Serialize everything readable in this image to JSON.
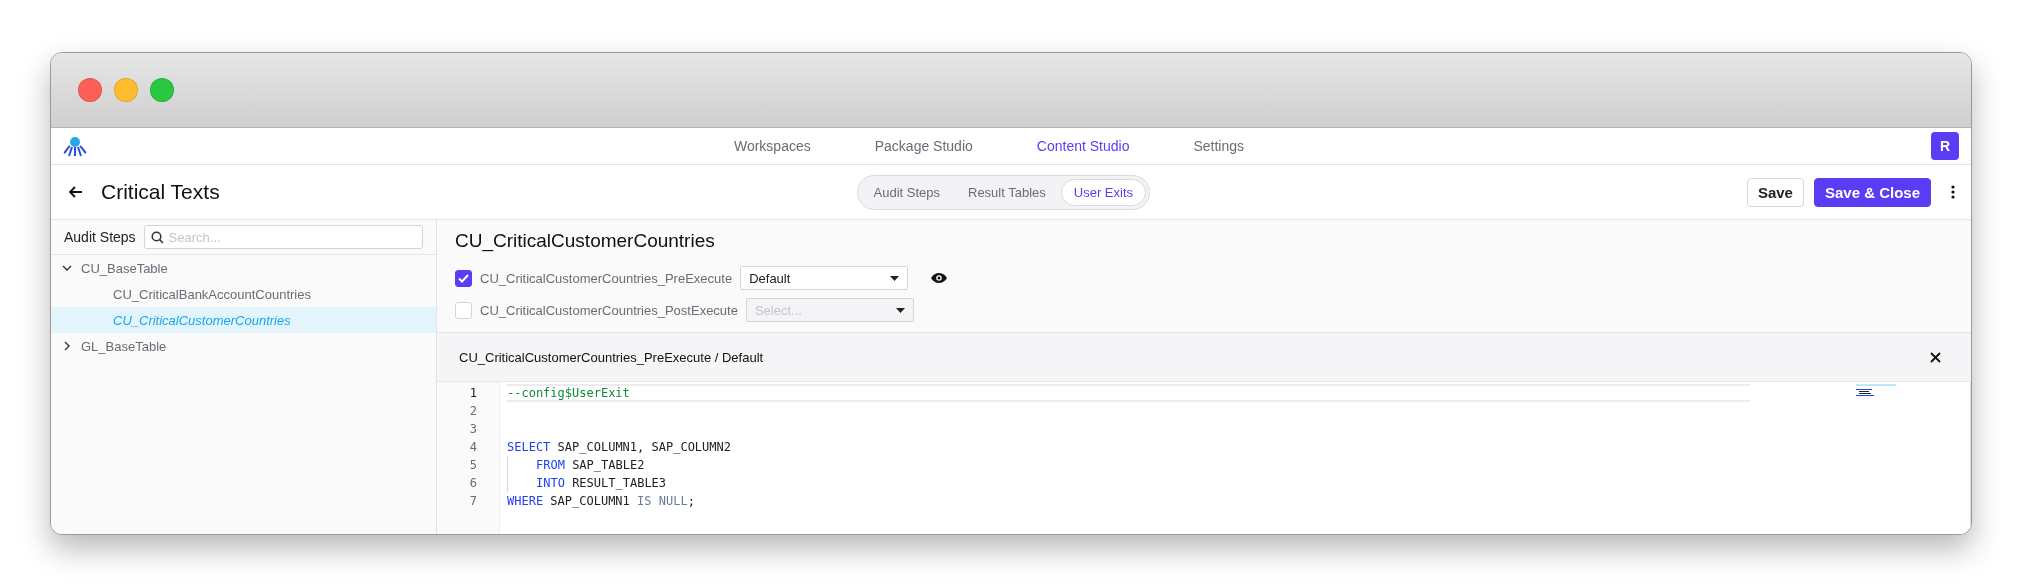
{
  "nav": {
    "items": [
      {
        "label": "Workspaces",
        "selected": false
      },
      {
        "label": "Package Studio",
        "selected": false
      },
      {
        "label": "Content Studio",
        "selected": true
      },
      {
        "label": "Settings",
        "selected": false
      }
    ],
    "avatar": "R"
  },
  "header": {
    "title": "Critical Texts",
    "tabs": [
      {
        "label": "Audit Steps",
        "selected": false
      },
      {
        "label": "Result Tables",
        "selected": false
      },
      {
        "label": "User Exits",
        "selected": true
      }
    ],
    "buttons": [
      {
        "label": "Save",
        "kind": "secondary"
      },
      {
        "label": "Save & Close",
        "kind": "primary"
      }
    ]
  },
  "sidebar": {
    "title": "Audit Steps",
    "search": {
      "placeholder": "Search..."
    },
    "tree": [
      {
        "label": "CU_BaseTable",
        "expanded": true,
        "selected": false,
        "children": [
          {
            "label": "CU_CriticalBankAccountCountries",
            "selected": false
          },
          {
            "label": "CU_CriticalCustomerCountries",
            "selected": true
          }
        ]
      },
      {
        "label": "GL_BaseTable",
        "expanded": false,
        "selected": false
      }
    ]
  },
  "main": {
    "title": "CU_CriticalCustomerCountries",
    "exits": [
      {
        "label": "CU_CriticalCustomerCountries_PreExecute",
        "checked": true,
        "value": "Default",
        "preview": true
      },
      {
        "label": "CU_CriticalCustomerCountries_PostExecute",
        "checked": false,
        "placeholder": "Select...",
        "preview": false
      }
    ],
    "editor": {
      "title": "CU_CriticalCustomerCountries_PreExecute / Default",
      "lines": [
        {
          "number": "1",
          "active": true,
          "indented": false,
          "tokens": [
            {
              "text": "--config$UserExit",
              "kind": "comment"
            }
          ]
        },
        {
          "number": "2",
          "active": false
        },
        {
          "number": "3",
          "active": false
        },
        {
          "number": "4",
          "active": false,
          "indented": false,
          "tokens": [
            {
              "text": "SELECT",
              "kind": "keyword"
            },
            {
              "text": " SAP_COLUMN1, SAP_COLUMN2",
              "kind": "plain"
            }
          ]
        },
        {
          "number": "5",
          "active": false,
          "indented": true,
          "tokens": [
            {
              "text": "FROM",
              "kind": "keyword"
            },
            {
              "text": " SAP_TABLE2",
              "kind": "plain"
            }
          ]
        },
        {
          "number": "6",
          "active": false,
          "indented": true,
          "tokens": [
            {
              "text": "INTO",
              "kind": "keyword"
            },
            {
              "text": " RESULT_TABLE3",
              "kind": "plain"
            }
          ]
        },
        {
          "number": "7",
          "active": false,
          "indented": false,
          "tokens": [
            {
              "text": "WHERE",
              "kind": "keyword"
            },
            {
              "text": " SAP_COLUMN1 ",
              "kind": "plain"
            },
            {
              "text": "IS NULL",
              "kind": "operator"
            },
            {
              "text": ";",
              "kind": "plain"
            }
          ]
        }
      ]
    }
  }
}
